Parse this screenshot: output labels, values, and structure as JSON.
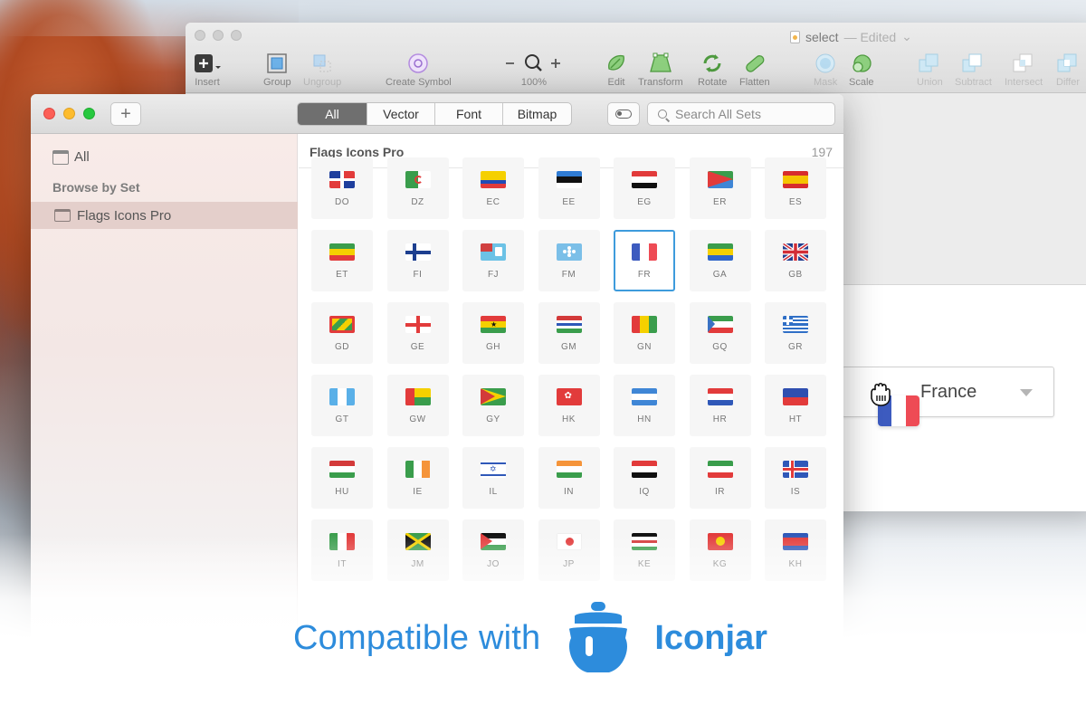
{
  "sketch": {
    "title": "select",
    "edited_label": "— Edited",
    "toolbar": [
      {
        "name": "insert",
        "label": "Insert",
        "dim": false
      },
      {
        "name": "group",
        "label": "Group",
        "dim": false
      },
      {
        "name": "ungroup",
        "label": "Ungroup",
        "dim": true
      },
      {
        "name": "create-symbol",
        "label": "Create Symbol",
        "dim": false
      },
      {
        "name": "zoom",
        "label": "100%",
        "dim": false
      },
      {
        "name": "edit",
        "label": "Edit",
        "dim": false
      },
      {
        "name": "transform",
        "label": "Transform",
        "dim": false
      },
      {
        "name": "rotate",
        "label": "Rotate",
        "dim": false
      },
      {
        "name": "flatten",
        "label": "Flatten",
        "dim": false
      },
      {
        "name": "mask",
        "label": "Mask",
        "dim": true
      },
      {
        "name": "scale",
        "label": "Scale",
        "dim": false
      },
      {
        "name": "union",
        "label": "Union",
        "dim": true
      },
      {
        "name": "subtract",
        "label": "Subtract",
        "dim": true
      },
      {
        "name": "intersect",
        "label": "Intersect",
        "dim": true
      },
      {
        "name": "difference",
        "label": "Differ",
        "dim": true
      }
    ],
    "select_value": "France"
  },
  "iconjar": {
    "add_label": "+",
    "filters": [
      "All",
      "Vector",
      "Font",
      "Bitmap"
    ],
    "active_filter": "All",
    "search_placeholder": "Search All Sets",
    "sidebar": {
      "all_label": "All",
      "section_header": "Browse by Set",
      "selected_set": "Flags Icons Pro"
    },
    "set_title": "Flags Icons Pro",
    "set_count": "197",
    "selected_code": "FR",
    "rows": [
      [
        "DO",
        "DZ",
        "EC",
        "EE",
        "EG",
        "ER",
        "ES"
      ],
      [
        "ET",
        "FI",
        "FJ",
        "FM",
        "FR",
        "GA",
        "GB"
      ],
      [
        "GD",
        "GE",
        "GH",
        "GM",
        "GN",
        "GQ",
        "GR"
      ],
      [
        "GT",
        "GW",
        "GY",
        "HK",
        "HN",
        "HR",
        "HT"
      ],
      [
        "HU",
        "IE",
        "IL",
        "IN",
        "IQ",
        "IR",
        "IS"
      ],
      [
        "IT",
        "JM",
        "JO",
        "JP",
        "KE",
        "KG",
        "KH"
      ]
    ]
  },
  "banner": {
    "text": "Compatible with",
    "brand": "Iconjar"
  },
  "colors": {
    "accent": "#2d8cdc",
    "selection_border": "#3e9bdc",
    "sidebar_selected": "#e4cfcb"
  }
}
